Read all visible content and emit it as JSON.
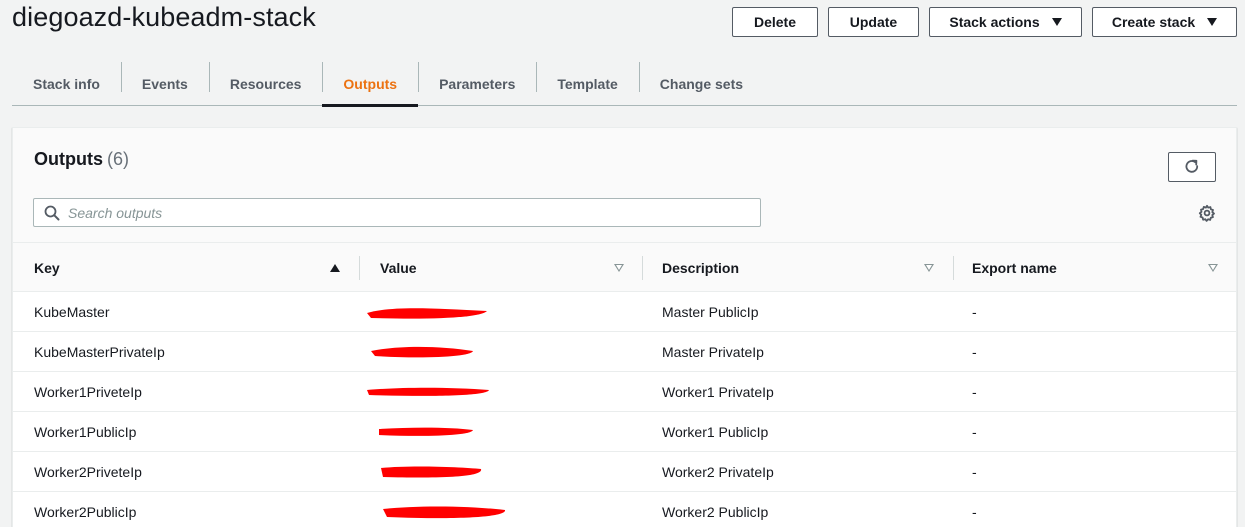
{
  "stack": {
    "title": "diegoazd-kubeadm-stack"
  },
  "actions": {
    "delete": "Delete",
    "update": "Update",
    "stack_actions": "Stack actions",
    "create_stack": "Create stack"
  },
  "tabs": [
    {
      "label": "Stack info"
    },
    {
      "label": "Events"
    },
    {
      "label": "Resources"
    },
    {
      "label": "Outputs",
      "active": true
    },
    {
      "label": "Parameters"
    },
    {
      "label": "Template"
    },
    {
      "label": "Change sets"
    }
  ],
  "outputs": {
    "title": "Outputs",
    "count": "(6)",
    "search_placeholder": "Search outputs",
    "columns": {
      "key": "Key",
      "value": "Value",
      "description": "Description",
      "export_name": "Export name"
    },
    "sort": {
      "column": "key",
      "direction": "ascending"
    },
    "rows": [
      {
        "key": "KubeMaster",
        "value_redacted": true,
        "description": "Master PublicIp",
        "export_name": "-"
      },
      {
        "key": "KubeMasterPrivateIp",
        "value_redacted": true,
        "description": "Master PrivateIp",
        "export_name": "-"
      },
      {
        "key": "Worker1PriveteIp",
        "value_redacted": true,
        "description": "Worker1 PrivateIp",
        "export_name": "-"
      },
      {
        "key": "Worker1PublicIp",
        "value_redacted": true,
        "description": "Worker1 PublicIp",
        "export_name": "-"
      },
      {
        "key": "Worker2PriveteIp",
        "value_redacted": true,
        "description": "Worker2 PrivateIp",
        "export_name": "-"
      },
      {
        "key": "Worker2PublicIp",
        "value_redacted": true,
        "description": "Worker2 PublicIp",
        "export_name": "-"
      }
    ]
  },
  "colors": {
    "accent": "#ec7211",
    "text": "#16191f",
    "redaction": "#ff0000",
    "background": "#f2f3f3"
  },
  "icons": [
    "refresh-icon",
    "search-icon",
    "settings-gear-icon",
    "caret-down-icon",
    "sort-ascending-icon",
    "sort-descending-icon"
  ]
}
